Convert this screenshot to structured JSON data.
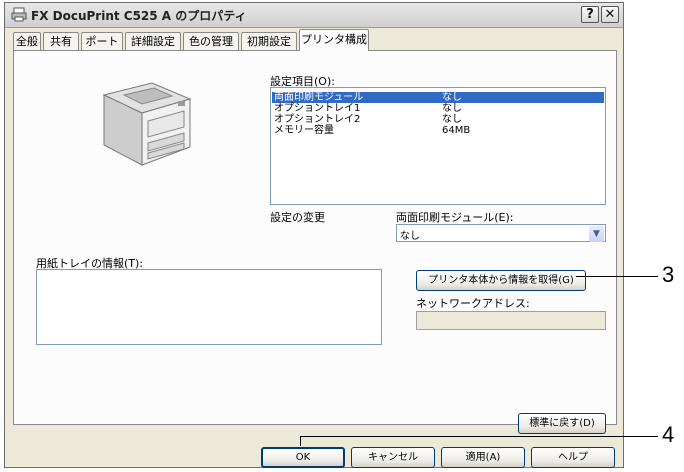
{
  "window": {
    "title": "FX DocuPrint C525 A のプロパティ",
    "help_glyph": "?",
    "close_glyph": "✕"
  },
  "tabs": [
    {
      "label": "全般"
    },
    {
      "label": "共有"
    },
    {
      "label": "ポート"
    },
    {
      "label": "詳細設定"
    },
    {
      "label": "色の管理"
    },
    {
      "label": "初期設定"
    },
    {
      "label": "プリンタ構成",
      "active": true
    }
  ],
  "settings": {
    "label": "設定項目(O):",
    "items": [
      {
        "name": "両面印刷モジュール",
        "value": "なし",
        "selected": true
      },
      {
        "name": "オプショントレイ1",
        "value": "なし"
      },
      {
        "name": "オプショントレイ2",
        "value": "なし"
      },
      {
        "name": "メモリー容量",
        "value": "64MB"
      }
    ]
  },
  "change": {
    "label": "設定の変更",
    "field_label": "両面印刷モジュール(E):",
    "value": "なし"
  },
  "tray": {
    "label": "用紙トレイの情報(T):"
  },
  "get_info_button": "プリンタ本体から情報を取得(G)",
  "network": {
    "label": "ネットワークアドレス:",
    "value": ""
  },
  "restore_button": "標準に戻す(D)",
  "footer": {
    "ok": "OK",
    "cancel": "キャンセル",
    "apply": "適用(A)",
    "help": "ヘルプ"
  },
  "callouts": [
    "3",
    "4"
  ],
  "icons": {
    "window_icon": "printer-icon",
    "dropdown": "chevron-down-icon"
  },
  "colors": {
    "selection": "#316ac5",
    "window_bg": "#ece9d8"
  }
}
